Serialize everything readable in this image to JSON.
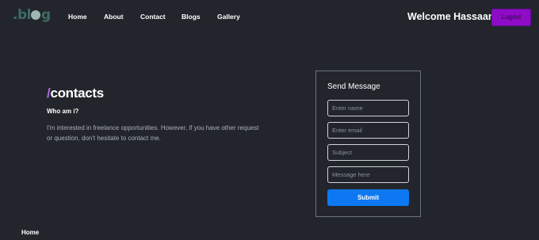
{
  "header": {
    "logo": {
      "prefix": ".bl",
      "suffix": "g"
    },
    "nav": [
      {
        "label": "Home"
      },
      {
        "label": "About"
      },
      {
        "label": "Contact"
      },
      {
        "label": "Blogs"
      },
      {
        "label": "Gallery"
      }
    ],
    "welcome": "Welcome Hassaan!",
    "logout_label": "Logout"
  },
  "contacts": {
    "slash": "/",
    "title": "contacts",
    "subtitle": "Who am i?",
    "description": "I'm interested in freelance opportunities. However, if you have other request or question, don't hesitate to contact me."
  },
  "form": {
    "title": "Send Message",
    "name_placeholder": "Enter name",
    "email_placeholder": "Enter email",
    "subject_placeholder": "Subject",
    "message_placeholder": "Message here",
    "submit_label": "Submit"
  },
  "footer": {
    "home_label": "Home"
  },
  "colors": {
    "background": "#22262c",
    "accent_purple": "#8e0cc8",
    "submit_blue": "#0d78f2"
  }
}
